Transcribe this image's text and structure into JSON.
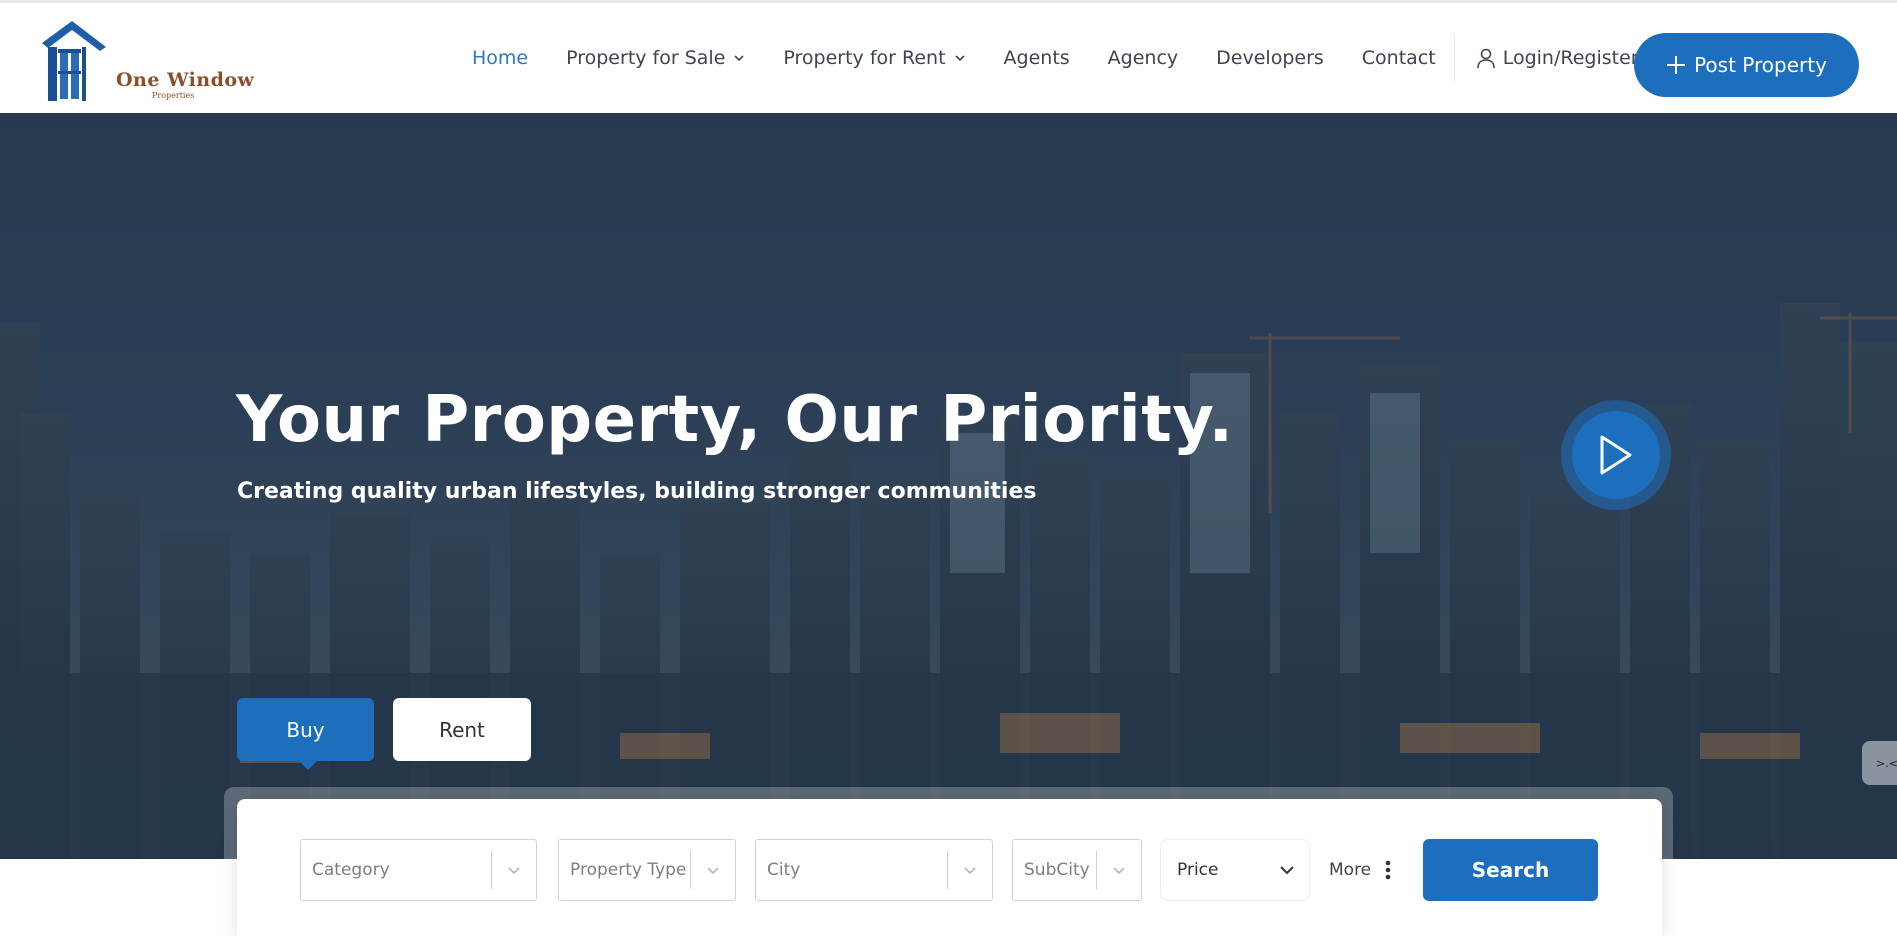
{
  "brand": {
    "name": "One Window",
    "tagline": "Properties"
  },
  "nav": {
    "home": "Home",
    "sale": "Property for Sale",
    "rent": "Property for Rent",
    "agents": "Agents",
    "agency": "Agency",
    "developers": "Developers",
    "contact": "Contact",
    "login": "Login/Register",
    "post": "Post Property"
  },
  "hero": {
    "title": "Your Property, Our Priority.",
    "subtitle": "Creating quality urban lifestyles, building stronger communities",
    "side_tab": ">.<"
  },
  "tabs": {
    "buy": "Buy",
    "rent": "Rent",
    "active": "Buy"
  },
  "search": {
    "category": "Category",
    "property_type": "Property Type",
    "city": "City",
    "subcity": "SubCity",
    "price": "Price",
    "more": "More",
    "button": "Search"
  },
  "icons": {
    "logo": "house-window-logo",
    "chevron": "chevron-down-icon",
    "user": "user-icon",
    "plus": "plus-icon",
    "play": "play-icon",
    "dots": "vertical-dots-icon"
  },
  "colors": {
    "primary": "#1d6fbe",
    "nav_active": "#2d78c2",
    "nav_text": "#3e4450",
    "logo_text": "#8a4f2a"
  }
}
